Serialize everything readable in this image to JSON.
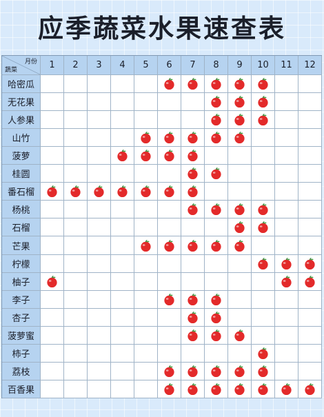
{
  "title": "应季蔬菜水果速查表",
  "corner": {
    "month_label": "月份",
    "veg_label": "蔬菜"
  },
  "months": [
    "1",
    "2",
    "3",
    "4",
    "5",
    "6",
    "7",
    "8",
    "9",
    "10",
    "11",
    "12"
  ],
  "marker_icon": "apple-icon",
  "colors": {
    "marker_red": "#e32a2a",
    "header_bg": "#b6d3f0",
    "page_bg": "#d9eafb"
  },
  "rows": [
    {
      "name": "哈密瓜",
      "months": [
        6,
        7,
        8,
        9,
        10
      ]
    },
    {
      "name": "无花果",
      "months": [
        8,
        9,
        10
      ]
    },
    {
      "name": "人参果",
      "months": [
        8,
        9,
        10
      ]
    },
    {
      "name": "山竹",
      "months": [
        5,
        6,
        7,
        8,
        9
      ]
    },
    {
      "name": "菠萝",
      "months": [
        4,
        5,
        6,
        7
      ]
    },
    {
      "name": "桂圆",
      "months": [
        7,
        8
      ]
    },
    {
      "name": "番石榴",
      "months": [
        1,
        2,
        3,
        4,
        5,
        6,
        7
      ]
    },
    {
      "name": "杨桃",
      "months": [
        7,
        8,
        9,
        10
      ]
    },
    {
      "name": "石榴",
      "months": [
        9,
        10
      ]
    },
    {
      "name": "芒果",
      "months": [
        5,
        6,
        7,
        8,
        9
      ]
    },
    {
      "name": "柠檬",
      "months": [
        10,
        11,
        12
      ]
    },
    {
      "name": "柚子",
      "months": [
        1,
        11,
        12
      ]
    },
    {
      "name": "李子",
      "months": [
        6,
        7,
        8
      ]
    },
    {
      "name": "杏子",
      "months": [
        7,
        8
      ]
    },
    {
      "name": "菠萝蜜",
      "months": [
        7,
        8,
        9
      ]
    },
    {
      "name": "柿子",
      "months": [
        10
      ]
    },
    {
      "name": "荔枝",
      "months": [
        6,
        7,
        8,
        9,
        10
      ]
    },
    {
      "name": "百香果",
      "months": [
        6,
        7,
        8,
        9,
        10,
        11,
        12
      ]
    }
  ]
}
